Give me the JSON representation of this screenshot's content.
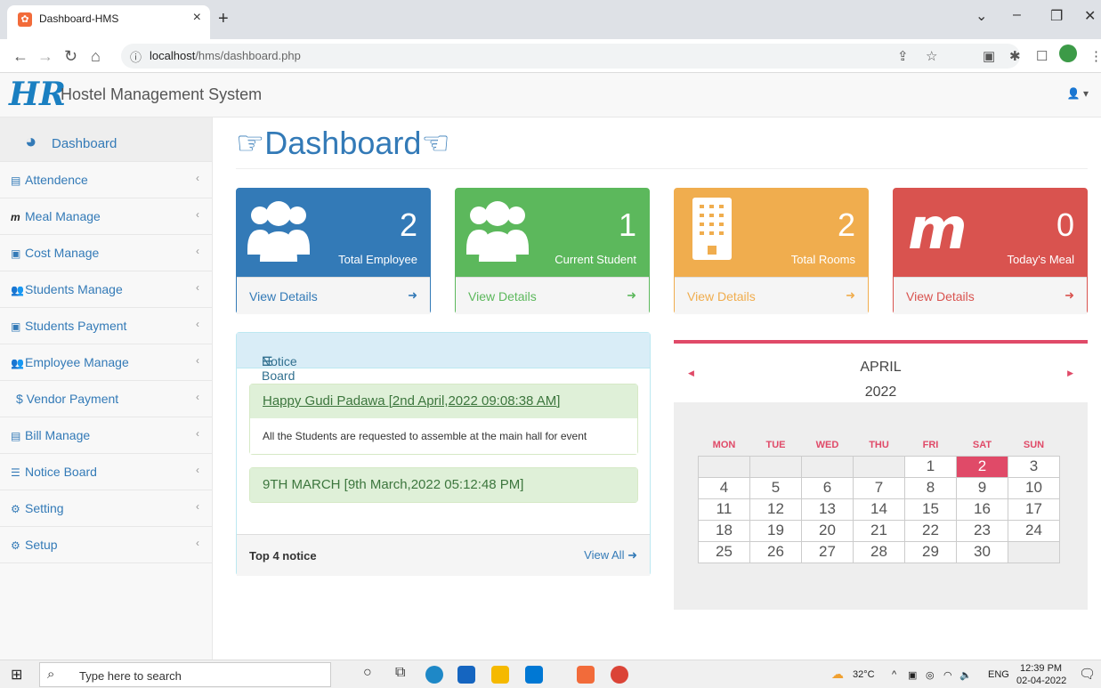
{
  "browser": {
    "tab_title": "Dashboard-HMS",
    "tab_close": "×",
    "new_tab": "+",
    "url_host": "localhost",
    "url_path": "/hms/dashboard.php"
  },
  "app": {
    "logo_text": "HR",
    "brand": "Hostel Management System",
    "user_menu": "▾"
  },
  "sidebar": {
    "items": [
      {
        "label": "Dashboard",
        "icon": "dashboard-icon"
      },
      {
        "label": "Attendence",
        "icon": "file-icon"
      },
      {
        "label": "Meal Manage",
        "icon": "meal-icon"
      },
      {
        "label": "Cost Manage",
        "icon": "money-icon"
      },
      {
        "label": "Students Manage",
        "icon": "users-icon"
      },
      {
        "label": "Students Payment",
        "icon": "money-icon"
      },
      {
        "label": "Employee Manage",
        "icon": "users-icon"
      },
      {
        "label": "$ Vendor Payment",
        "icon": "dollar-icon"
      },
      {
        "label": "Bill Manage",
        "icon": "file-icon"
      },
      {
        "label": "Notice Board",
        "icon": "list-icon"
      },
      {
        "label": "Setting",
        "icon": "gear-icon"
      },
      {
        "label": "Setup",
        "icon": "gears-icon"
      }
    ],
    "chevron": "‹"
  },
  "page": {
    "title": "Dashboard"
  },
  "stats": [
    {
      "value": "2",
      "caption": "Total Employee",
      "link": "View Details",
      "color": "#337ab7"
    },
    {
      "value": "1",
      "caption": "Current Student",
      "link": "View Details",
      "color": "#5cb85c"
    },
    {
      "value": "2",
      "caption": "Total Rooms",
      "link": "View Details",
      "color": "#f0ad4e"
    },
    {
      "value": "0",
      "caption": "Today's Meal",
      "link": "View Details",
      "color": "#d9534f"
    }
  ],
  "notice_board": {
    "heading": "Notice Board",
    "notices": [
      {
        "title": "Happy Gudi Padawa [2nd April,2022 09:08:38 AM]",
        "body": "All the Students are requested to assemble at the main hall for event"
      },
      {
        "title": "9TH MARCH  [9th March,2022 05:12:48 PM]"
      }
    ],
    "footer_label": "Top 4 notice",
    "view_all": "View All"
  },
  "calendar": {
    "month": "APRIL",
    "year": "2022",
    "weekdays": [
      "MON",
      "TUE",
      "WED",
      "THU",
      "FRI",
      "SAT",
      "SUN"
    ],
    "weeks": [
      [
        "",
        "",
        "",
        "",
        "1",
        "2",
        "3"
      ],
      [
        "4",
        "5",
        "6",
        "7",
        "8",
        "9",
        "10"
      ],
      [
        "11",
        "12",
        "13",
        "14",
        "15",
        "16",
        "17"
      ],
      [
        "18",
        "19",
        "20",
        "21",
        "22",
        "23",
        "24"
      ],
      [
        "25",
        "26",
        "27",
        "28",
        "29",
        "30",
        ""
      ]
    ],
    "today": "2",
    "accent": "#e04a68"
  },
  "taskbar": {
    "search_placeholder": "Type here to search",
    "weather": "32°C",
    "language": "ENG",
    "time": "12:39 PM",
    "date": "02-04-2022"
  }
}
